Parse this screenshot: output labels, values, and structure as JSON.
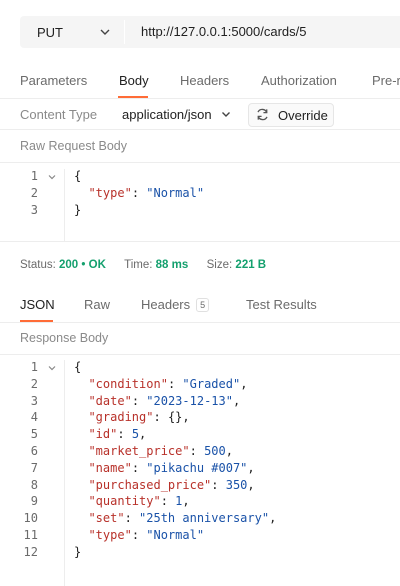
{
  "request": {
    "method": "PUT",
    "url": "http://127.0.0.1:5000/cards/5"
  },
  "request_tabs": [
    "Parameters",
    "Body",
    "Headers",
    "Authorization",
    "Pre-r"
  ],
  "active_request_tab": "Body",
  "body_options": {
    "content_type_label": "Content Type",
    "content_type_value": "application/json",
    "override_label": "Override"
  },
  "raw_request_title": "Raw Request Body",
  "request_body_lines": [
    {
      "n": "1",
      "fold": true,
      "t": "{"
    },
    {
      "n": "2",
      "fold": false,
      "t": "  \"type\": \"Normal\""
    },
    {
      "n": "3",
      "fold": false,
      "t": "}"
    }
  ],
  "status": {
    "status_label": "Status:",
    "status_code": "200",
    "status_text": "OK",
    "time_label": "Time:",
    "time_value": "88 ms",
    "size_label": "Size:",
    "size_value": "221 B"
  },
  "response_tabs": [
    {
      "label": "JSON"
    },
    {
      "label": "Raw"
    },
    {
      "label": "Headers",
      "badge": "5"
    },
    {
      "label": "Test Results"
    }
  ],
  "active_response_tab": "JSON",
  "response_title": "Response Body",
  "response_lines": [
    {
      "n": "1",
      "fold": true,
      "t": "{"
    },
    {
      "n": "2",
      "fold": false,
      "t": "  \"condition\": \"Graded\","
    },
    {
      "n": "3",
      "fold": false,
      "t": "  \"date\": \"2023-12-13\","
    },
    {
      "n": "4",
      "fold": false,
      "t": "  \"grading\": {},"
    },
    {
      "n": "5",
      "fold": false,
      "t": "  \"id\": 5,"
    },
    {
      "n": "6",
      "fold": false,
      "t": "  \"market_price\": 500,"
    },
    {
      "n": "7",
      "fold": false,
      "t": "  \"name\": \"pikachu #007\","
    },
    {
      "n": "8",
      "fold": false,
      "t": "  \"purchased_price\": 350,"
    },
    {
      "n": "9",
      "fold": false,
      "t": "  \"quantity\": 1,"
    },
    {
      "n": "10",
      "fold": false,
      "t": "  \"set\": \"25th anniversary\","
    },
    {
      "n": "11",
      "fold": false,
      "t": "  \"type\": \"Normal\""
    },
    {
      "n": "12",
      "fold": false,
      "t": "}"
    }
  ],
  "colors": {
    "accent": "#ff6c37",
    "status_ok": "#14a06e",
    "json_key": "#b8312a",
    "json_value": "#1a52a8"
  }
}
